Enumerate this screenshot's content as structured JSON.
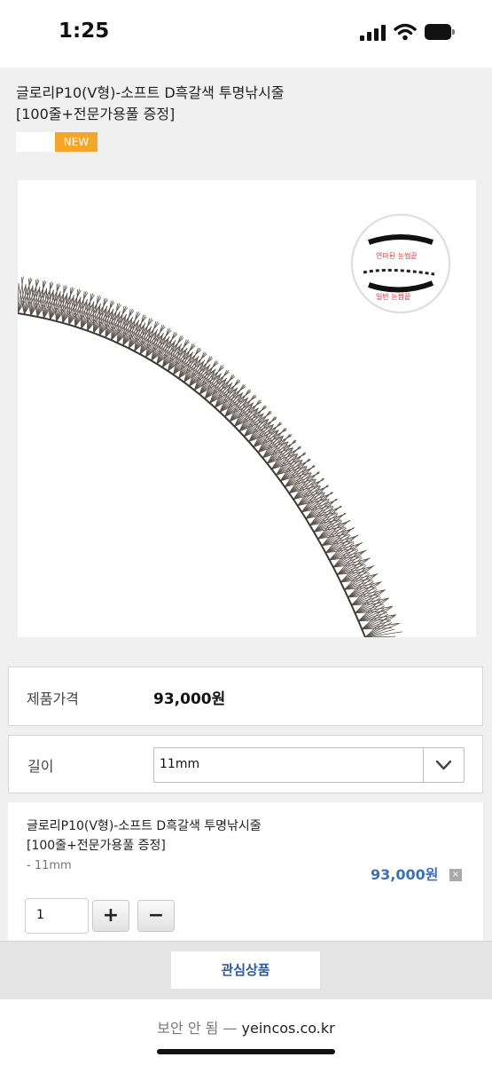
{
  "status_bar": {
    "time": "1:25"
  },
  "product": {
    "title_line1": "글로리P10(V형)-소프트 D흑갈색 투명낚시줄",
    "title_line2": "[100줄+전문가용풀 증정]",
    "badge_new": "NEW",
    "image_inset": {
      "label_top": "연마된 눈썹끝",
      "label_bottom": "일반 눈썹끝"
    }
  },
  "price_row": {
    "label": "제품가격",
    "value": "93,000원"
  },
  "option_row": {
    "label": "길이",
    "selected": "11mm"
  },
  "selected_item": {
    "title_line1": "글로리P10(V형)-소프트 D흑갈색 투명낚시줄",
    "title_line2": "[100줄+전문가용풀 증정]",
    "option": "- 11mm",
    "price": "93,000원",
    "quantity": "1",
    "plus": "+",
    "minus": "−",
    "remove": "×"
  },
  "bottom_bar": {
    "wishlist_label": "관심상품"
  },
  "browser": {
    "security": "보안 안 됨",
    "separator": "—",
    "domain": "yeincos.co.kr"
  }
}
